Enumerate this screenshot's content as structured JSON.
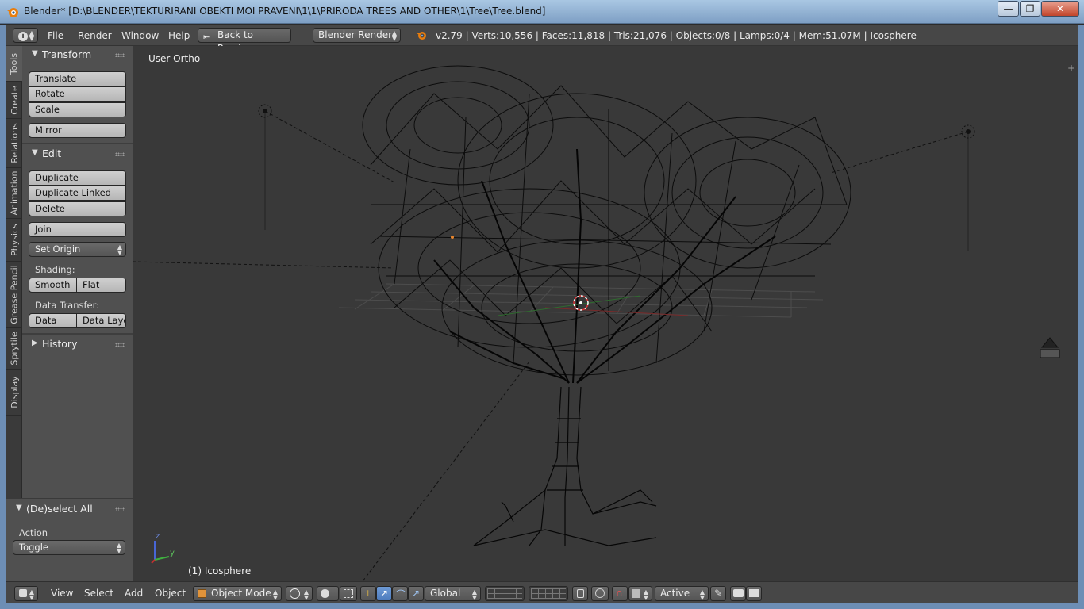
{
  "window": {
    "title": "Blender* [D:\\BLENDER\\TEKTURIRANI OBEKTI MOI PRAVENI\\1\\1\\PRIRODA TREES AND OTHER\\1\\Tree\\Tree.blend]",
    "minimize": "—",
    "maximize": "❐",
    "close": "✕"
  },
  "infobar": {
    "menus": [
      "File",
      "Render",
      "Window",
      "Help"
    ],
    "back_button": "Back to Previous",
    "render_engine": "Blender Render",
    "stats": "v2.79 | Verts:10,556 | Faces:11,818 | Tris:21,076 | Objects:0/8 | Lamps:0/4 | Mem:51.07M | Icosphere"
  },
  "tabs": [
    "Tools",
    "Create",
    "Relations",
    "Animation",
    "Physics",
    "Grease Pencil",
    "Sprytile",
    "Display"
  ],
  "toolshelf": {
    "transform": {
      "title": "Transform",
      "translate": "Translate",
      "rotate": "Rotate",
      "scale": "Scale",
      "mirror": "Mirror"
    },
    "edit": {
      "title": "Edit",
      "duplicate": "Duplicate",
      "duplicate_linked": "Duplicate Linked",
      "delete": "Delete",
      "join": "Join",
      "set_origin": "Set Origin",
      "shading_label": "Shading:",
      "smooth": "Smooth",
      "flat": "Flat",
      "data_transfer_label": "Data Transfer:",
      "data": "Data",
      "data_layout": "Data Layo"
    },
    "history": {
      "title": "History"
    }
  },
  "operator": {
    "title": "(De)select All",
    "action_label": "Action",
    "action_value": "Toggle"
  },
  "viewport": {
    "view_name": "User Ortho",
    "active_object": "(1) Icosphere",
    "axis_z": "z",
    "axis_y": "y"
  },
  "bottombar": {
    "menus": [
      "View",
      "Select",
      "Add",
      "Object"
    ],
    "mode": "Object Mode",
    "orientation": "Global",
    "pivot_active": "Active"
  },
  "colors": {
    "viewport_bg": "#393939",
    "panel_bg": "#505050",
    "header_bg": "#474747",
    "accent_blue": "#5680c2",
    "wire": "#000000"
  }
}
